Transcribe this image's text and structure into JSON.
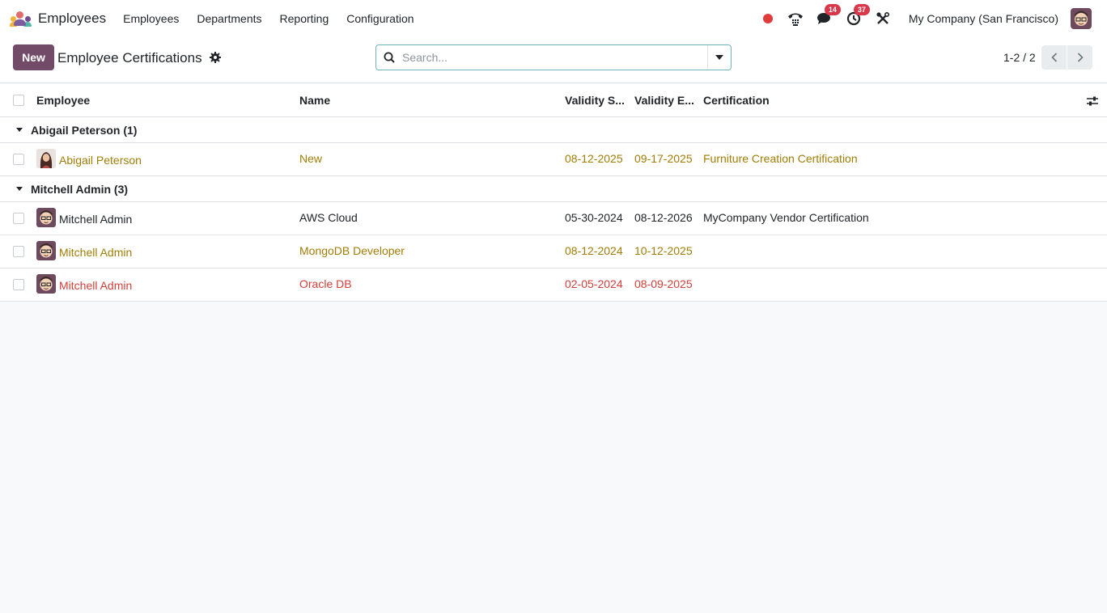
{
  "navbar": {
    "app_name": "Employees",
    "menu": [
      "Employees",
      "Departments",
      "Reporting",
      "Configuration"
    ],
    "messages_count": "14",
    "activities_count": "37",
    "company": "My Company (San Francisco)"
  },
  "control_panel": {
    "new_label": "New",
    "title": "Employee Certifications",
    "search_placeholder": "Search...",
    "pager": "1-2 / 2"
  },
  "list": {
    "columns": [
      "Employee",
      "Name",
      "Validity S...",
      "Validity E...",
      "Certification"
    ],
    "groups": [
      {
        "label": "Abigail Peterson (1)",
        "rows": [
          {
            "employee": "Abigail Peterson",
            "name": "New",
            "validity_start": "08-12-2025",
            "validity_end": "09-17-2025",
            "certification": "Furniture Creation Certification",
            "status": "warning"
          }
        ]
      },
      {
        "label": "Mitchell Admin (3)",
        "rows": [
          {
            "employee": "Mitchell Admin",
            "name": "AWS Cloud",
            "validity_start": "05-30-2024",
            "validity_end": "08-12-2026",
            "certification": "MyCompany Vendor Certification",
            "status": "ok"
          },
          {
            "employee": "Mitchell Admin",
            "name": "MongoDB Developer",
            "validity_start": "08-12-2024",
            "validity_end": "10-12-2025",
            "certification": "",
            "status": "warning"
          },
          {
            "employee": "Mitchell Admin",
            "name": "Oracle DB",
            "validity_start": "02-05-2024",
            "validity_end": "08-09-2025",
            "certification": "",
            "status": "danger"
          }
        ]
      }
    ]
  },
  "colors": {
    "brand": "#714b67",
    "warning_text": "#a07d07",
    "danger_text": "#d23f3a",
    "badge": "#d9384a",
    "recording_dot": "#e03c3c"
  },
  "icons": [
    "app-logo-icon",
    "phone-icon",
    "chat-icon",
    "clock-icon",
    "tools-icon",
    "gear-icon",
    "search-icon",
    "caret-down-icon",
    "chevron-left-icon",
    "chevron-right-icon",
    "sliders-icon"
  ]
}
